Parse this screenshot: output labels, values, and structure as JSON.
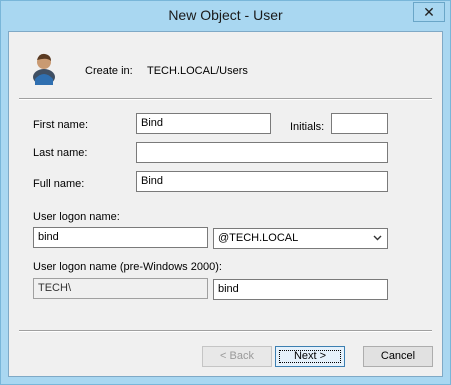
{
  "window": {
    "title": "New Object - User",
    "close_glyph": "✕"
  },
  "header": {
    "icon": "user-icon",
    "create_in_label": "Create in:",
    "create_in_value": "TECH.LOCAL/Users"
  },
  "form": {
    "first_name_label": "First name:",
    "first_name_value": "Bind",
    "initials_label": "Initials:",
    "initials_value": "",
    "last_name_label": "Last name:",
    "last_name_value": "",
    "full_name_label": "Full name:",
    "full_name_value": "Bind",
    "logon_name_label": "User logon name:",
    "logon_name_value": "bind",
    "domain_selected": "@TECH.LOCAL",
    "pre2000_label": "User logon name (pre-Windows 2000):",
    "pre2000_domain": "TECH\\",
    "pre2000_value": "bind"
  },
  "buttons": {
    "back": "< Back",
    "next": "Next >",
    "cancel": "Cancel"
  },
  "colors": {
    "titlebar": "#a9d7f1",
    "dialog_bg": "#f0f0f0",
    "default_button_border": "#3c7fb1"
  }
}
